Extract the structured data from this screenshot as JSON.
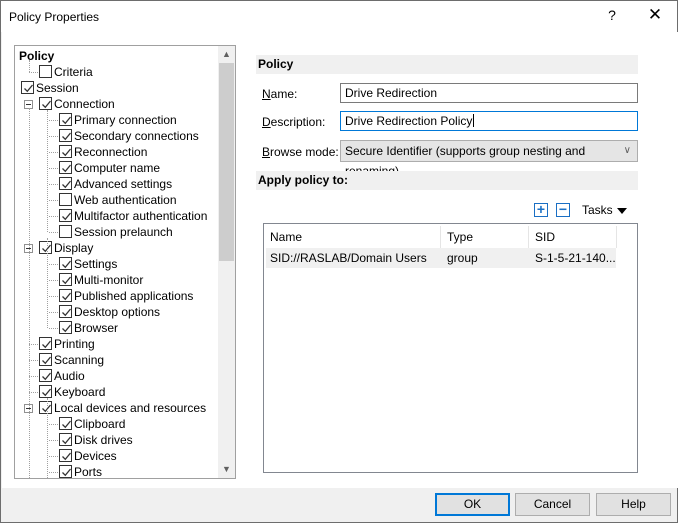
{
  "window": {
    "title": "Policy Properties",
    "help_glyph": "?",
    "close_glyph": "✕"
  },
  "tree": {
    "root": "Policy",
    "nodes": [
      {
        "label": "Criteria",
        "checked": false,
        "level": 1
      },
      {
        "label": "Session",
        "checked": true,
        "level": 0
      },
      {
        "label": "Connection",
        "checked": true,
        "level": 1,
        "expanded": true
      },
      {
        "label": "Primary connection",
        "checked": true,
        "level": 2
      },
      {
        "label": "Secondary connections",
        "checked": true,
        "level": 2
      },
      {
        "label": "Reconnection",
        "checked": true,
        "level": 2
      },
      {
        "label": "Computer name",
        "checked": true,
        "level": 2
      },
      {
        "label": "Advanced settings",
        "checked": true,
        "level": 2
      },
      {
        "label": "Web authentication",
        "checked": false,
        "level": 2
      },
      {
        "label": "Multifactor authentication",
        "checked": true,
        "level": 2
      },
      {
        "label": "Session prelaunch",
        "checked": false,
        "level": 2
      },
      {
        "label": "Display",
        "checked": true,
        "level": 1,
        "expanded": true
      },
      {
        "label": "Settings",
        "checked": true,
        "level": 2
      },
      {
        "label": "Multi-monitor",
        "checked": true,
        "level": 2
      },
      {
        "label": "Published applications",
        "checked": true,
        "level": 2
      },
      {
        "label": "Desktop options",
        "checked": true,
        "level": 2
      },
      {
        "label": "Browser",
        "checked": true,
        "level": 2
      },
      {
        "label": "Printing",
        "checked": true,
        "level": 1
      },
      {
        "label": "Scanning",
        "checked": true,
        "level": 1
      },
      {
        "label": "Audio",
        "checked": true,
        "level": 1
      },
      {
        "label": "Keyboard",
        "checked": true,
        "level": 1
      },
      {
        "label": "Local devices and resources",
        "checked": true,
        "level": 1,
        "expanded": true
      },
      {
        "label": "Clipboard",
        "checked": true,
        "level": 2
      },
      {
        "label": "Disk drives",
        "checked": true,
        "level": 2
      },
      {
        "label": "Devices",
        "checked": true,
        "level": 2
      },
      {
        "label": "Ports",
        "checked": true,
        "level": 2
      }
    ]
  },
  "policy": {
    "section_title": "Policy",
    "name_label": "Name:",
    "name_accel": "N",
    "name_rest": "ame:",
    "name_value": "Drive Redirection",
    "description_accel": "D",
    "description_rest": "escription:",
    "description_value": "Drive Redirection Policy",
    "browse_accel": "B",
    "browse_rest": "rowse mode:",
    "browse_value": "Secure Identifier (supports group nesting and renaming)"
  },
  "apply": {
    "section_title": "Apply policy to:",
    "add_glyph": "+",
    "remove_glyph": "−",
    "tasks_label": "Tasks",
    "columns": [
      "Name",
      "Type",
      "SID"
    ],
    "rows": [
      {
        "name": "SID://RASLAB/Domain Users",
        "type": "group",
        "sid": "S-1-5-21-140..."
      }
    ]
  },
  "footer": {
    "ok": "OK",
    "cancel": "Cancel",
    "help": "Help"
  },
  "colors": {
    "accent": "#0078d7",
    "icon_blue": "#1a6fc4"
  }
}
